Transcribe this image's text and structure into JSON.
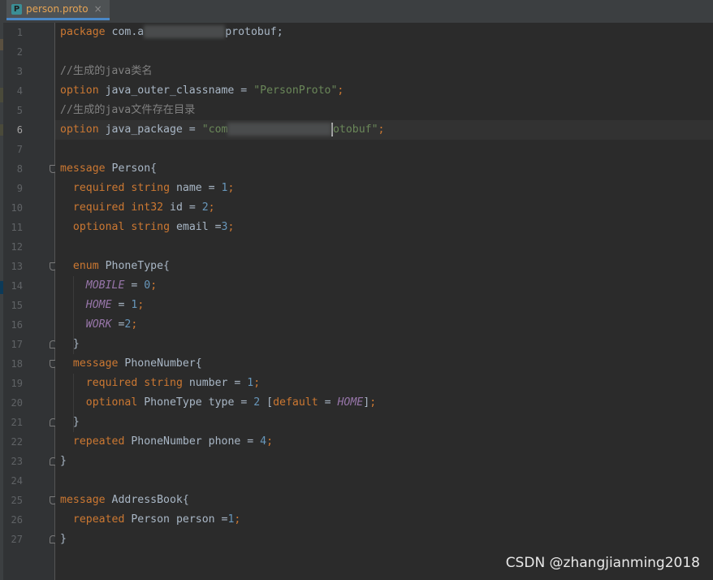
{
  "tab": {
    "icon_letter": "P",
    "label": "person.proto",
    "close_glyph": "×"
  },
  "current_line": 6,
  "lines": [
    {
      "n": "1",
      "tokens": [
        {
          "t": "kw",
          "v": "package"
        },
        {
          "t": "plain",
          "v": " com.a"
        },
        {
          "t": "redact"
        },
        {
          "t": "plain",
          "v": "protobuf;"
        }
      ]
    },
    {
      "n": "2",
      "tokens": []
    },
    {
      "n": "3",
      "tokens": [
        {
          "t": "cm",
          "v": "//生成的java类名"
        }
      ]
    },
    {
      "n": "4",
      "tokens": [
        {
          "t": "kw",
          "v": "option"
        },
        {
          "t": "plain",
          "v": " java_outer_classname = "
        },
        {
          "t": "str",
          "v": "\"PersonProto\""
        },
        {
          "t": "kw",
          "v": ";"
        }
      ]
    },
    {
      "n": "5",
      "tokens": [
        {
          "t": "cm",
          "v": "//生成的java文件存在目录"
        }
      ]
    },
    {
      "n": "6",
      "tokens": [
        {
          "t": "kw",
          "v": "option"
        },
        {
          "t": "plain",
          "v": " java_package = "
        },
        {
          "t": "str",
          "v": "\"com"
        },
        {
          "t": "redact"
        },
        {
          "t": "caret"
        },
        {
          "t": "str",
          "v": "otobuf\""
        },
        {
          "t": "kw",
          "v": ";"
        }
      ]
    },
    {
      "n": "7",
      "tokens": []
    },
    {
      "n": "8",
      "tokens": [
        {
          "t": "kw",
          "v": "message"
        },
        {
          "t": "plain",
          "v": " Person{"
        }
      ]
    },
    {
      "n": "9",
      "tokens": [
        {
          "t": "plain",
          "v": "  "
        },
        {
          "t": "kw",
          "v": "required"
        },
        {
          "t": "plain",
          "v": " "
        },
        {
          "t": "kw",
          "v": "string"
        },
        {
          "t": "plain",
          "v": " name = "
        },
        {
          "t": "num",
          "v": "1"
        },
        {
          "t": "kw",
          "v": ";"
        }
      ]
    },
    {
      "n": "10",
      "tokens": [
        {
          "t": "plain",
          "v": "  "
        },
        {
          "t": "kw",
          "v": "required"
        },
        {
          "t": "plain",
          "v": " "
        },
        {
          "t": "kw",
          "v": "int32"
        },
        {
          "t": "plain",
          "v": " id = "
        },
        {
          "t": "num",
          "v": "2"
        },
        {
          "t": "kw",
          "v": ";"
        }
      ]
    },
    {
      "n": "11",
      "tokens": [
        {
          "t": "plain",
          "v": "  "
        },
        {
          "t": "kw",
          "v": "optional"
        },
        {
          "t": "plain",
          "v": " "
        },
        {
          "t": "kw",
          "v": "string"
        },
        {
          "t": "plain",
          "v": " email ="
        },
        {
          "t": "num",
          "v": "3"
        },
        {
          "t": "kw",
          "v": ";"
        }
      ]
    },
    {
      "n": "12",
      "tokens": []
    },
    {
      "n": "13",
      "tokens": [
        {
          "t": "plain",
          "v": "  "
        },
        {
          "t": "kw",
          "v": "enum"
        },
        {
          "t": "plain",
          "v": " PhoneType{"
        }
      ]
    },
    {
      "n": "14",
      "tokens": [
        {
          "t": "plain",
          "v": "    "
        },
        {
          "t": "enumc",
          "v": "MOBILE"
        },
        {
          "t": "plain",
          "v": " = "
        },
        {
          "t": "num",
          "v": "0"
        },
        {
          "t": "kw",
          "v": ";"
        }
      ]
    },
    {
      "n": "15",
      "tokens": [
        {
          "t": "plain",
          "v": "    "
        },
        {
          "t": "enumc",
          "v": "HOME"
        },
        {
          "t": "plain",
          "v": " = "
        },
        {
          "t": "num",
          "v": "1"
        },
        {
          "t": "kw",
          "v": ";"
        }
      ]
    },
    {
      "n": "16",
      "tokens": [
        {
          "t": "plain",
          "v": "    "
        },
        {
          "t": "enumc",
          "v": "WORK"
        },
        {
          "t": "plain",
          "v": " ="
        },
        {
          "t": "num",
          "v": "2"
        },
        {
          "t": "kw",
          "v": ";"
        }
      ]
    },
    {
      "n": "17",
      "tokens": [
        {
          "t": "plain",
          "v": "  }"
        }
      ]
    },
    {
      "n": "18",
      "tokens": [
        {
          "t": "plain",
          "v": "  "
        },
        {
          "t": "kw",
          "v": "message"
        },
        {
          "t": "plain",
          "v": " PhoneNumber{"
        }
      ]
    },
    {
      "n": "19",
      "tokens": [
        {
          "t": "plain",
          "v": "    "
        },
        {
          "t": "kw",
          "v": "required"
        },
        {
          "t": "plain",
          "v": " "
        },
        {
          "t": "kw",
          "v": "string"
        },
        {
          "t": "plain",
          "v": " number = "
        },
        {
          "t": "num",
          "v": "1"
        },
        {
          "t": "kw",
          "v": ";"
        }
      ]
    },
    {
      "n": "20",
      "tokens": [
        {
          "t": "plain",
          "v": "    "
        },
        {
          "t": "kw",
          "v": "optional"
        },
        {
          "t": "plain",
          "v": " PhoneType type = "
        },
        {
          "t": "num",
          "v": "2"
        },
        {
          "t": "plain",
          "v": " ["
        },
        {
          "t": "kw",
          "v": "default"
        },
        {
          "t": "plain",
          "v": " = "
        },
        {
          "t": "enumc",
          "v": "HOME"
        },
        {
          "t": "plain",
          "v": "]"
        },
        {
          "t": "kw",
          "v": ";"
        }
      ]
    },
    {
      "n": "21",
      "tokens": [
        {
          "t": "plain",
          "v": "  }"
        }
      ]
    },
    {
      "n": "22",
      "tokens": [
        {
          "t": "plain",
          "v": "  "
        },
        {
          "t": "kw",
          "v": "repeated"
        },
        {
          "t": "plain",
          "v": " PhoneNumber phone = "
        },
        {
          "t": "num",
          "v": "4"
        },
        {
          "t": "kw",
          "v": ";"
        }
      ]
    },
    {
      "n": "23",
      "tokens": [
        {
          "t": "plain",
          "v": "}"
        }
      ]
    },
    {
      "n": "24",
      "tokens": []
    },
    {
      "n": "25",
      "tokens": [
        {
          "t": "kw",
          "v": "message"
        },
        {
          "t": "plain",
          "v": " AddressBook{"
        }
      ]
    },
    {
      "n": "26",
      "tokens": [
        {
          "t": "plain",
          "v": "  "
        },
        {
          "t": "kw",
          "v": "repeated"
        },
        {
          "t": "plain",
          "v": " Person person ="
        },
        {
          "t": "num",
          "v": "1"
        },
        {
          "t": "kw",
          "v": ";"
        }
      ]
    },
    {
      "n": "27",
      "tokens": [
        {
          "t": "plain",
          "v": "}"
        }
      ]
    }
  ],
  "watermark": "CSDN @zhangjianming2018"
}
